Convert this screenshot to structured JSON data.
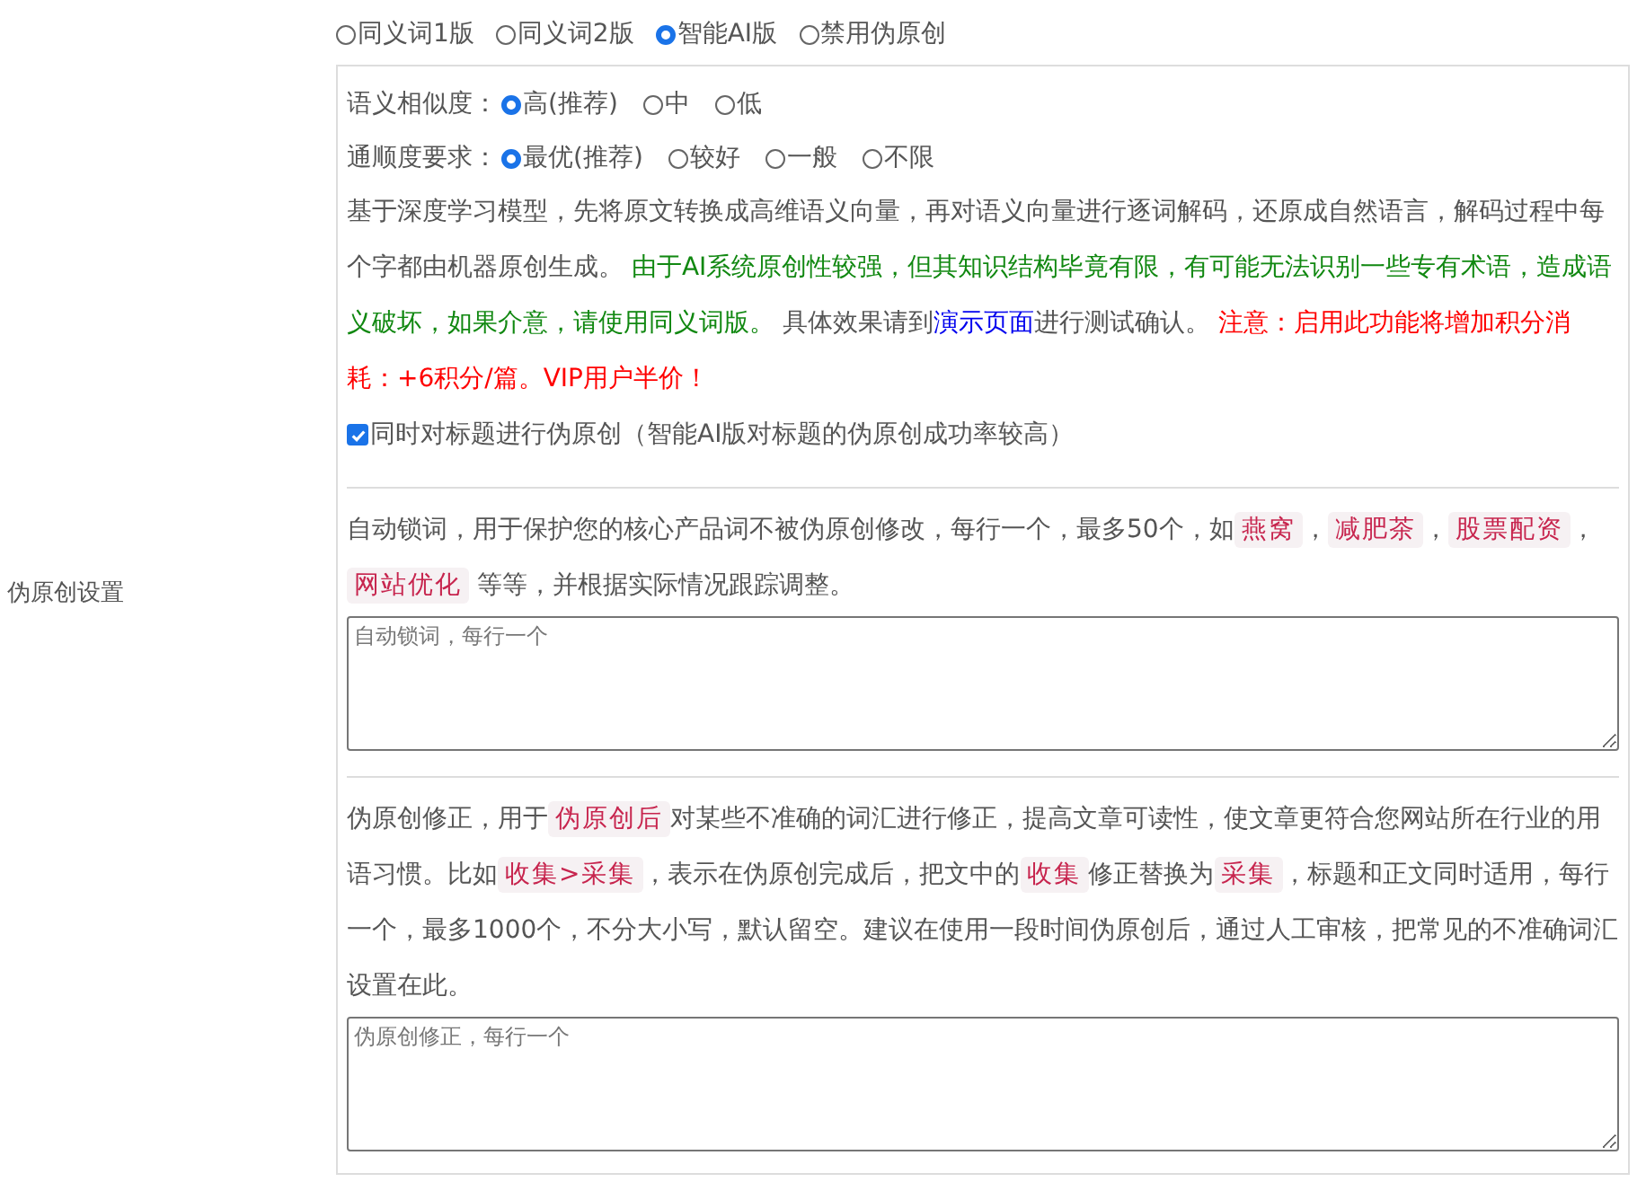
{
  "section_label": "伪原创设置",
  "mode_options": [
    {
      "label": "同义词1版",
      "selected": false
    },
    {
      "label": "同义词2版",
      "selected": false
    },
    {
      "label": "智能AI版",
      "selected": true
    },
    {
      "label": "禁用伪原创",
      "selected": false
    }
  ],
  "similarity": {
    "label": "语义相似度：",
    "options": [
      {
        "label": "高(推荐)",
        "selected": true
      },
      {
        "label": "中",
        "selected": false
      },
      {
        "label": "低",
        "selected": false
      }
    ]
  },
  "fluency": {
    "label": "通顺度要求：",
    "options": [
      {
        "label": "最优(推荐)",
        "selected": true
      },
      {
        "label": "较好",
        "selected": false
      },
      {
        "label": "一般",
        "selected": false
      },
      {
        "label": "不限",
        "selected": false
      }
    ]
  },
  "ai_description": [
    {
      "kind": "plain",
      "text": "基于深度学习模型，先将原文转换成高维语义向量，再对语义向量进行逐词解码，还原成自然语言，解码过程中每个字都由机器原创生成。 "
    },
    {
      "kind": "green",
      "text": "由于AI系统原创性较强，但其知识结构毕竟有限，有可能无法识别一些专有术语，造成语义破坏，如果介意，请使用同义词版。"
    },
    {
      "kind": "plain",
      "text": " 具体效果请到"
    },
    {
      "kind": "link",
      "text": "演示页面"
    },
    {
      "kind": "plain",
      "text": "进行测试确认。 "
    },
    {
      "kind": "red",
      "text": "注意：启用此功能将增加积分消耗：+6积分/篇。VIP用户半价！"
    }
  ],
  "title_rewrite": {
    "label": "同时对标题进行伪原创（智能AI版对标题的伪原创成功率较高）",
    "checked": true
  },
  "lock_words": {
    "description": [
      {
        "kind": "plain",
        "text": "自动锁词，用于保护您的核心产品词不被伪原创修改，每行一个，最多50个，如"
      },
      {
        "kind": "code",
        "text": "燕窝"
      },
      {
        "kind": "plain",
        "text": "，"
      },
      {
        "kind": "code",
        "text": "减肥茶"
      },
      {
        "kind": "plain",
        "text": "，"
      },
      {
        "kind": "code",
        "text": "股票配资"
      },
      {
        "kind": "plain",
        "text": "，"
      },
      {
        "kind": "code",
        "text": "网站优化"
      },
      {
        "kind": "plain",
        "text": " 等等，并根据实际情况跟踪调整。"
      }
    ],
    "placeholder": "自动锁词，每行一个"
  },
  "corrections": {
    "description": [
      {
        "kind": "plain",
        "text": "伪原创修正，用于"
      },
      {
        "kind": "code",
        "text": "伪原创后"
      },
      {
        "kind": "plain",
        "text": "对某些不准确的词汇进行修正，提高文章可读性，使文章更符合您网站所在行业的用语习惯。比如"
      },
      {
        "kind": "code",
        "text": "收集>采集"
      },
      {
        "kind": "plain",
        "text": "，表示在伪原创完成后，把文中的"
      },
      {
        "kind": "code",
        "text": "收集"
      },
      {
        "kind": "plain",
        "text": "修正替换为"
      },
      {
        "kind": "code",
        "text": "采集"
      },
      {
        "kind": "plain",
        "text": "，标题和正文同时适用，每行一个，最多1000个，不分大小写，默认留空。建议在使用一段时间伪原创后，通过人工审核，把常见的不准确词汇设置在此。"
      }
    ],
    "placeholder": "伪原创修正，每行一个"
  }
}
